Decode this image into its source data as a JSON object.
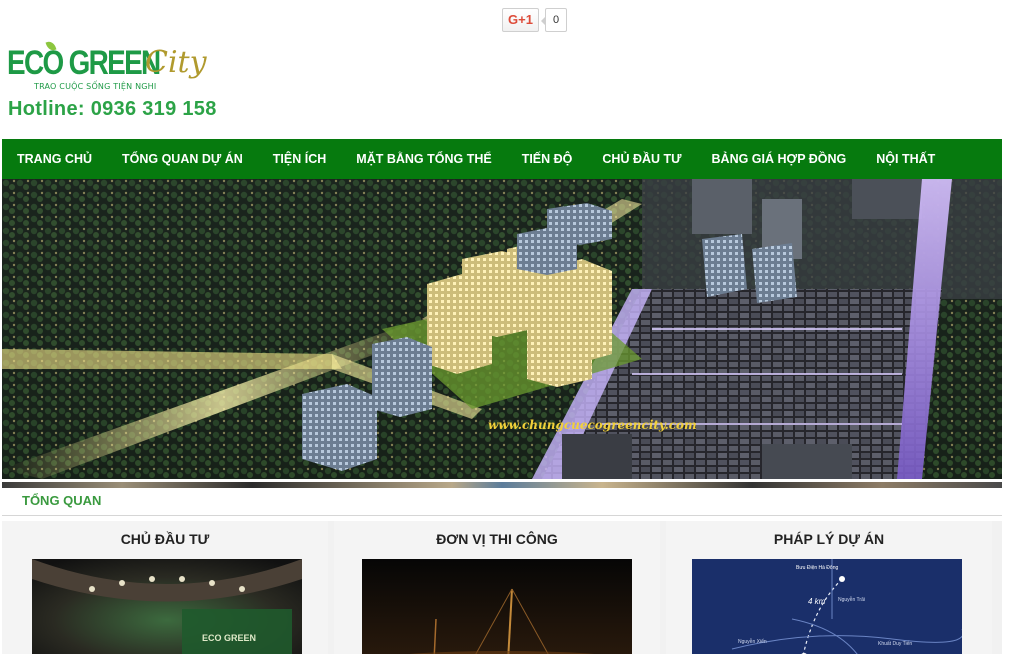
{
  "social": {
    "gplus_label": "G+1",
    "gplus_count": "0"
  },
  "brand": {
    "logo_main": "ECO GREEN",
    "logo_script": "City",
    "slogan": "TRAO CUỘC SỐNG TIỆN NGHI",
    "hotline": "Hotline: 0936 319 158",
    "primary_color": "#067a0e",
    "accent_color": "#2ca347"
  },
  "nav": {
    "items": [
      {
        "label": "TRANG CHỦ"
      },
      {
        "label": "TỔNG QUAN DỰ ÁN"
      },
      {
        "label": "TIỆN ÍCH"
      },
      {
        "label": "MẶT BẰNG TỔNG THỂ"
      },
      {
        "label": "TIẾN ĐỘ"
      },
      {
        "label": "CHỦ ĐẦU TƯ"
      },
      {
        "label": "BẢNG GIÁ HỢP ĐỒNG"
      },
      {
        "label": "NỘI THẤT"
      }
    ]
  },
  "banner": {
    "caption": "www.chungcuecogreencity.com"
  },
  "section": {
    "title": "TỔNG QUAN"
  },
  "cards": [
    {
      "title": "CHỦ ĐẦU TƯ",
      "image_text": "ECO GREEN"
    },
    {
      "title": "ĐƠN VỊ THI CÔNG"
    },
    {
      "title": "PHÁP LÝ DỰ ÁN",
      "map_labels": [
        "Bưu Điện Hà Đông",
        "4 km",
        "Nguyễn Trãi",
        "Khuất Duy Tiến",
        "Nguyễn Xiển"
      ]
    }
  ]
}
